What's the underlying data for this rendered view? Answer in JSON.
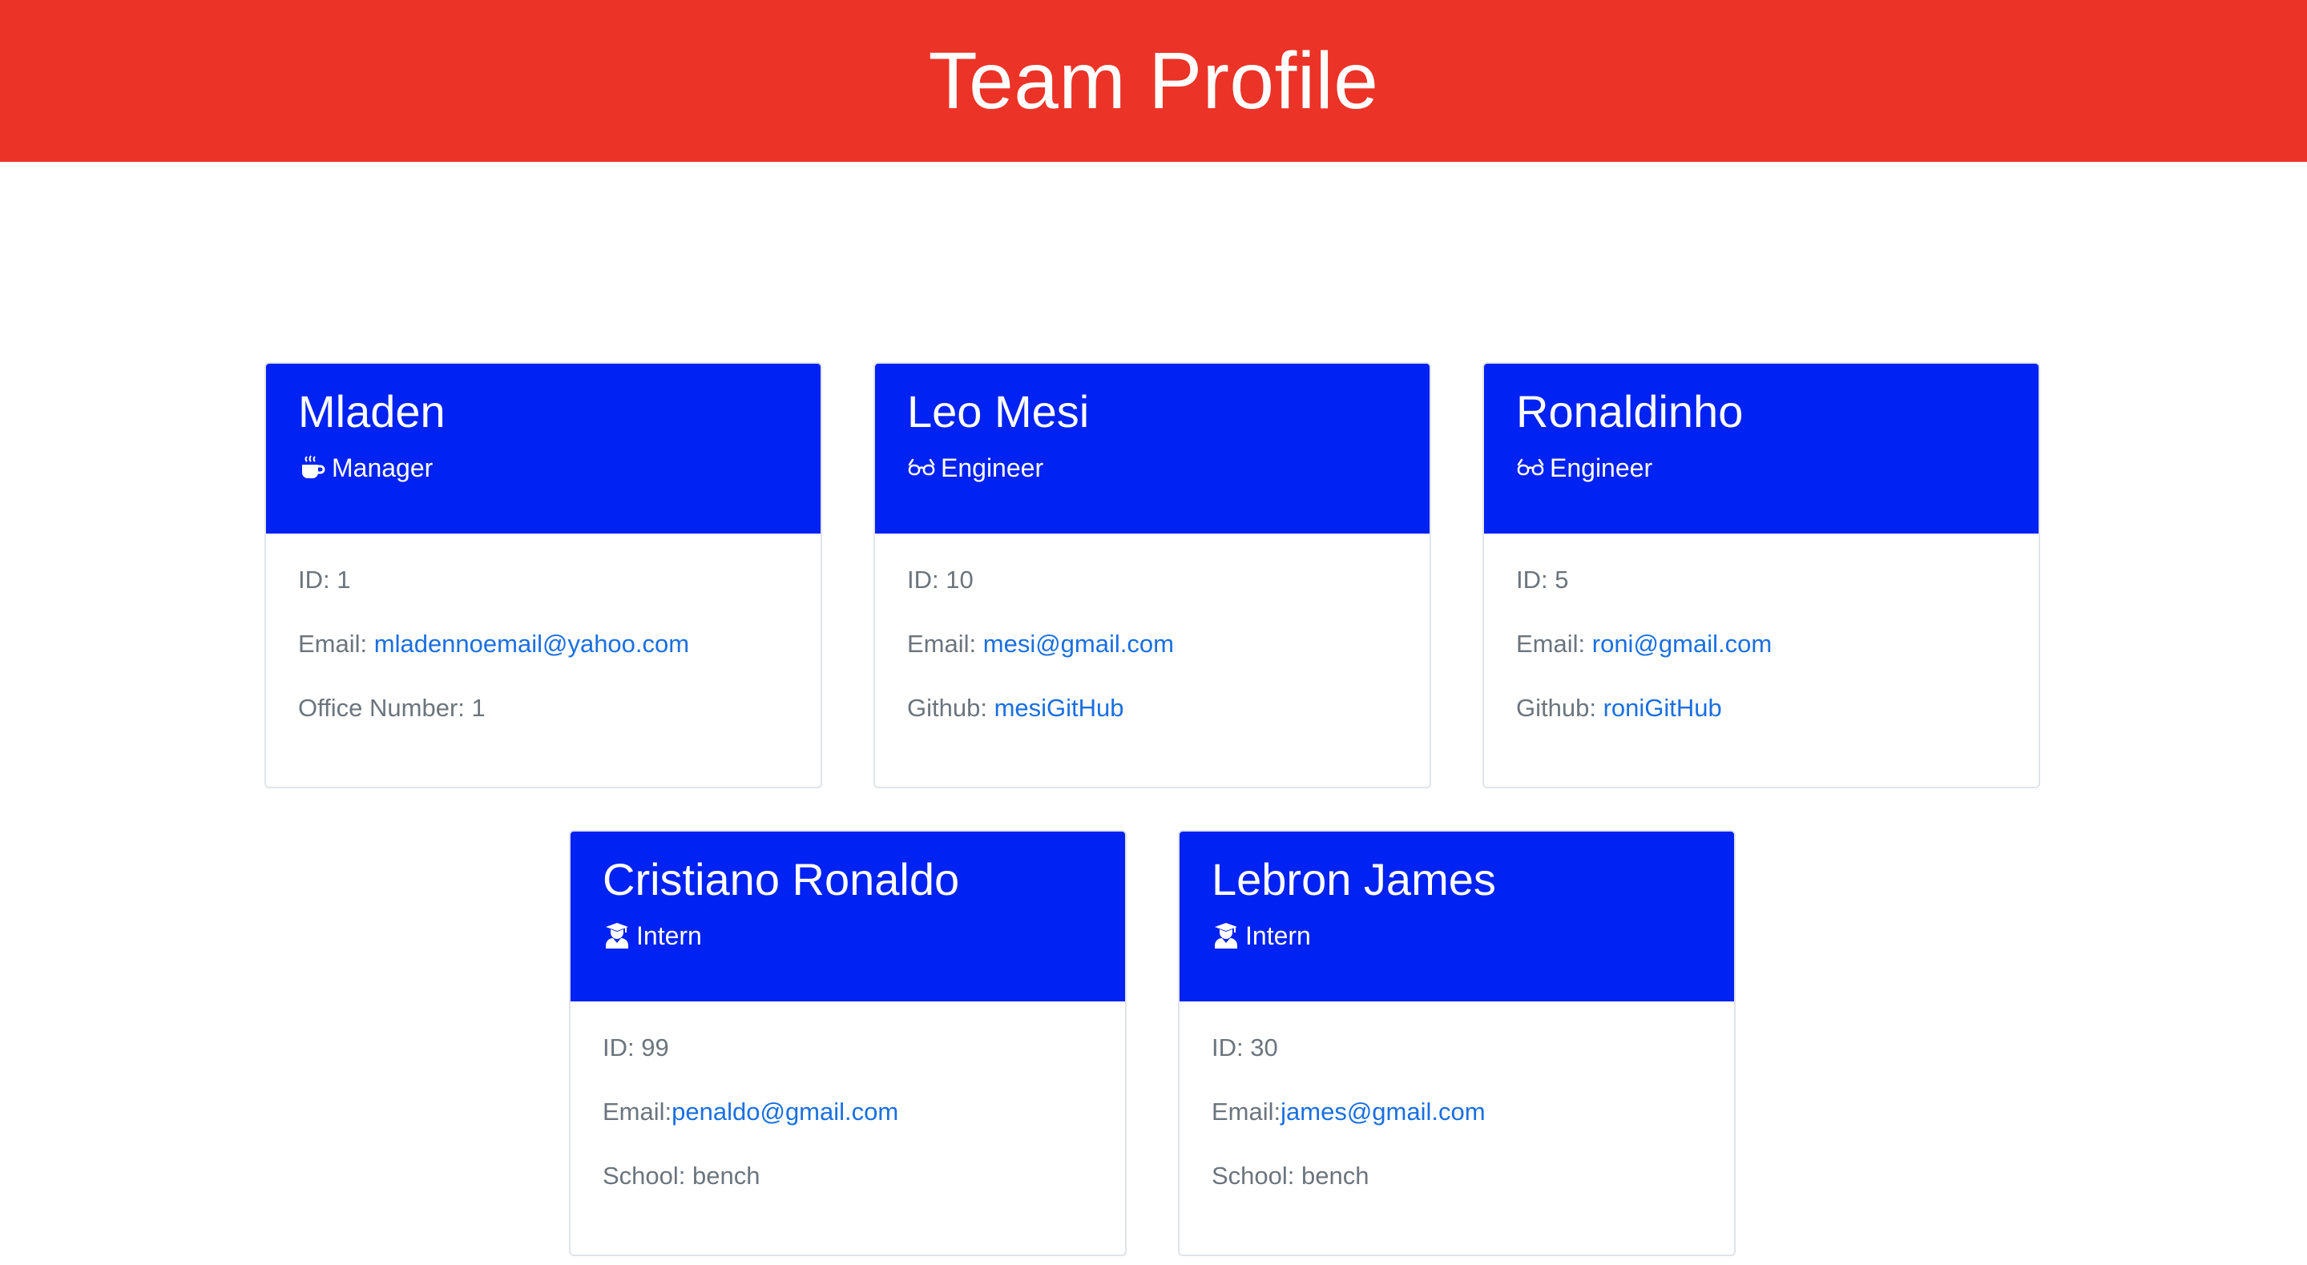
{
  "header": {
    "title": "Team Profile"
  },
  "colors": {
    "header_bg": "#ec3327",
    "card_head_bg": "#0022f2",
    "link": "#1a6fe0",
    "muted_text": "#6c757d"
  },
  "cards": [
    {
      "name": "Mladen",
      "role": "Manager",
      "role_icon": "mug-icon",
      "id_text": "ID: 1",
      "email_label": "Email: ",
      "email": "mladennoemail@yahoo.com",
      "extra_label": "Office Number: 1",
      "extra_value": ""
    },
    {
      "name": "Leo Mesi",
      "role": "Engineer",
      "role_icon": "glasses-icon",
      "id_text": "ID: 10",
      "email_label": "Email: ",
      "email": "mesi@gmail.com",
      "extra_label": "Github: ",
      "extra_value": "mesiGitHub"
    },
    {
      "name": "Ronaldinho",
      "role": "Engineer",
      "role_icon": "glasses-icon",
      "id_text": "ID: 5",
      "email_label": "Email: ",
      "email": "roni@gmail.com",
      "extra_label": "Github: ",
      "extra_value": "roniGitHub"
    },
    {
      "name": "Cristiano Ronaldo",
      "role": "Intern",
      "role_icon": "graduate-icon",
      "id_text": "ID: 99",
      "email_label": "Email:",
      "email": "penaldo@gmail.com",
      "extra_label": "School: bench",
      "extra_value": ""
    },
    {
      "name": "Lebron James",
      "role": "Intern",
      "role_icon": "graduate-icon",
      "id_text": "ID: 30",
      "email_label": "Email:",
      "email": "james@gmail.com",
      "extra_label": "School: bench",
      "extra_value": ""
    }
  ]
}
